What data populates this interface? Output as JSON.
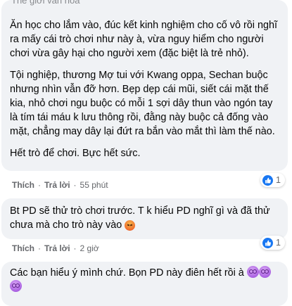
{
  "comment1": {
    "truncated_header": "Thế giới văn hóa",
    "paragraphs": [
      "Ăn học cho lắm vào, đúc kết kinh nghiệm cho cố vô rồi nghĩ ra mấy cái trò chơi như này à, vừa nguy hiểm cho người chơi vừa gây hại cho người xem (đặc biệt là trẻ nhỏ).",
      "Tội nghiệp, thương Mợ tui với Kwang oppa, Sechan buộc nhưng nhìn vẫn đỡ hơn. Bẹp dẹp cái mũi, siết cái mặt thế kia, nhỏ chơi ngu buộc có mỗi 1 sợi dây thun vào ngón tay là tím tái máu k lưu thông rồi, đằng này buộc cả đống vào mặt, chẳng may dây lại đứt ra bắn vào mắt thì làm thế nào.",
      "Hết trò để chơi. Bực hết sức."
    ],
    "actions": {
      "like": "Thích",
      "reply": "Trả lời",
      "time": "55 phút"
    },
    "reaction": {
      "icon": "like-icon",
      "count": "1",
      "color": "#1877f2"
    }
  },
  "comment2": {
    "text": "Bt PD sẽ thử trò chơi trước. T k hiểu PD nghĩ gì và đã thử chưa mà cho trò này vào",
    "emoji": "angry-emoji",
    "actions": {
      "like": "Thích",
      "reply": "Trả lời",
      "time": "2 giờ"
    },
    "reaction": {
      "icon": "like-icon",
      "count": "1",
      "color": "#1877f2"
    }
  },
  "comment3": {
    "text": "Các bạn hiểu ý mình chứ. Bọn PD này điên hết rồi à",
    "emojis": [
      "dizzy-face-emoji",
      "dizzy-face-emoji",
      "dizzy-face-emoji"
    ]
  },
  "colors": {
    "bubble": "#f0f2f5",
    "meta_text": "#65676b",
    "accent": "#1877f2"
  }
}
